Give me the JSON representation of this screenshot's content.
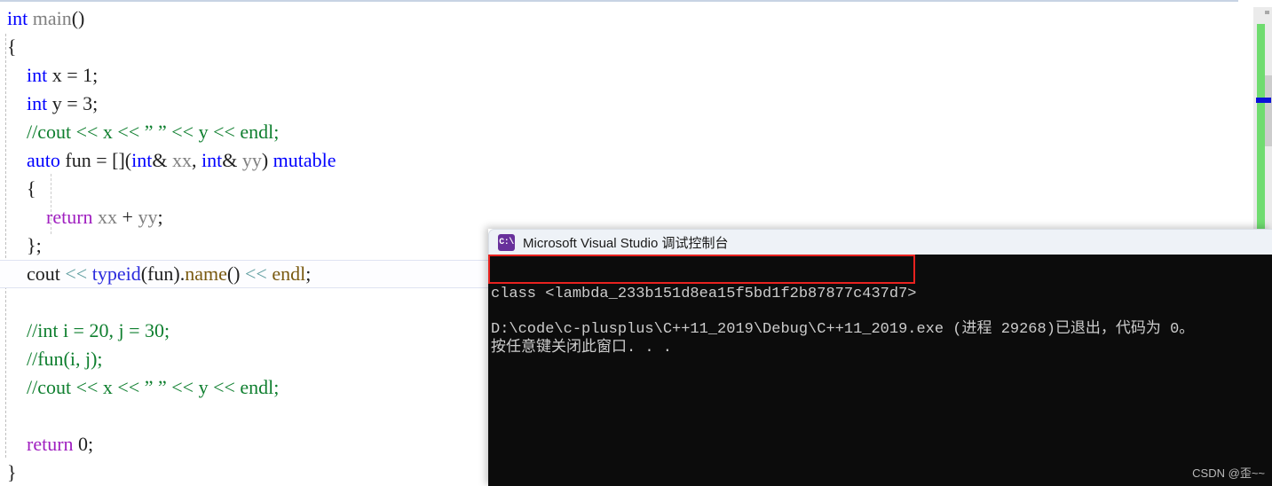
{
  "editor": {
    "name": "visual-studio-code-editor",
    "current_line_index": 9,
    "lines": [
      {
        "id": "l1",
        "text": "int main()"
      },
      {
        "id": "l2",
        "text": "{"
      },
      {
        "id": "l3",
        "text": "    int x = 1;"
      },
      {
        "id": "l4",
        "text": "    int y = 3;"
      },
      {
        "id": "l5",
        "text": "    //cout << x << \" \" << y << endl;"
      },
      {
        "id": "l6",
        "text": "    auto fun = [](int& xx, int& yy) mutable"
      },
      {
        "id": "l7",
        "text": "    {"
      },
      {
        "id": "l8",
        "text": "        return xx + yy;"
      },
      {
        "id": "l9",
        "text": "    };"
      },
      {
        "id": "l10",
        "text": "    cout << typeid(fun).name() << endl;"
      },
      {
        "id": "l11",
        "text": ""
      },
      {
        "id": "l12",
        "text": "    //int i = 20, j = 30;"
      },
      {
        "id": "l13",
        "text": "    //fun(i, j);"
      },
      {
        "id": "l14",
        "text": "    //cout << x << \" \" << y << endl;"
      },
      {
        "id": "l15",
        "text": ""
      },
      {
        "id": "l16",
        "text": "    return 0;"
      },
      {
        "id": "l17",
        "text": "}"
      }
    ],
    "colors": {
      "keyword": "#0000ff",
      "comment": "#0f7f2f",
      "identifier": "#808080",
      "return_keyword": "#a020c0",
      "function": "#7a5a10",
      "stream_operator": "#5f9ea0",
      "typeid": "#2b2bdd",
      "background": "#ffffff"
    }
  },
  "scrollbar": {
    "name": "editor-vertical-scrollbar",
    "change_bar_color": "#6fdc6f",
    "caret_marker_color": "#0b10d8",
    "thumb_color": "#cdcdcd"
  },
  "console": {
    "icon_label": "C:\\",
    "title": "Microsoft Visual Studio 调试控制台",
    "background": "#0c0c0c",
    "titlebar_background": "#eef2f7",
    "lines": [
      "class <lambda_233b151d8ea15f5bd1f2b87877c437d7>",
      "D:\\code\\c-plusplus\\C++11_2019\\Debug\\C++11_2019.exe (进程 29268)已退出，代码为 0。",
      "按任意键关闭此窗口. . ."
    ]
  },
  "annotation": {
    "name": "red-highlight-rectangle",
    "color": "#e8221f"
  },
  "watermark": {
    "text": "CSDN @歪~~"
  }
}
